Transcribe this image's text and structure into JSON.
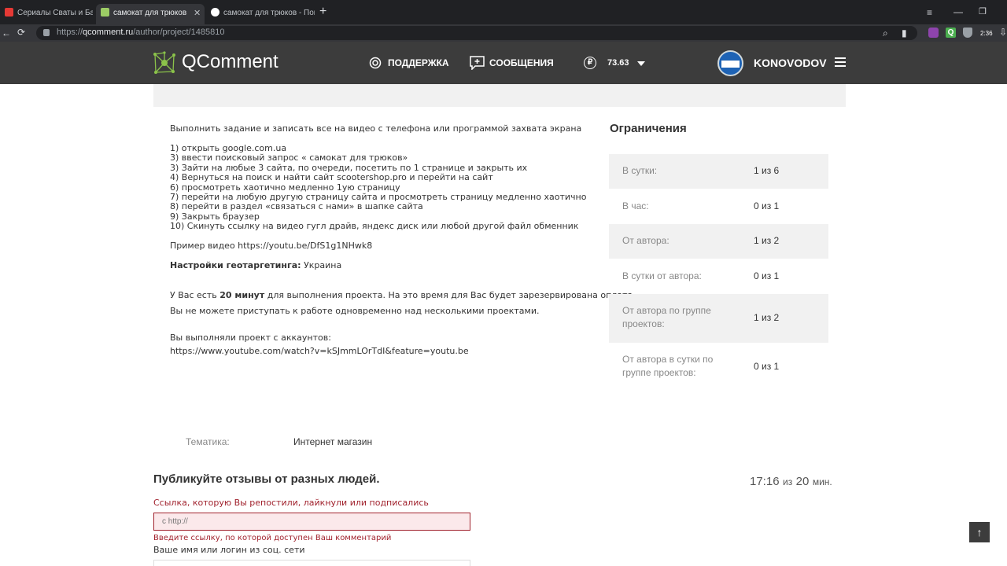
{
  "browser": {
    "tabs": [
      {
        "title": "Сериалы Сваты и Байки Мит",
        "active": false
      },
      {
        "title": "самокат для трюков",
        "active": true
      },
      {
        "title": "самокат для трюков - Пои",
        "active": false
      }
    ],
    "url_scheme": "https://",
    "url_host": "qcomment.ru",
    "url_path": "/author/project/1485810",
    "clock": "2:36"
  },
  "header": {
    "logo": "QComment",
    "support": "ПОДДЕРЖКА",
    "messages": "СООБЩЕНИЯ",
    "balance": "73.63",
    "username": "KONOVODOV"
  },
  "task": {
    "intro": "Выполнить задание и записать все на видео с телефона или программой захвата экрана",
    "steps": [
      "1) открыть google.com.ua",
      "3) ввести поисковый запрос « самокат для трюков»",
      "3) Зайти на любые 3 сайта, по очереди, посетить по 1 странице и закрыть их",
      "4) Вернуться на поиск и найти сайт scootershop.pro и перейти на сайт",
      "6) просмотреть хаотично медленно 1ую страницу",
      "7) перейти на любую другую страницу сайта и просмотреть страницу медленно хаотично",
      "8) перейти в раздел «связаться с нами» в шапке сайта",
      "9) Закрыть браузер",
      "10) Скинуть ссылку на видео гугл драйв, яндекс диск или любой другой файл обменник"
    ],
    "example": "Пример видео https://youtu.be/DfS1g1NHwk8",
    "geo_label": "Настройки геотаргетинга:",
    "geo_value": "Украина",
    "time_prefix": "У Вас есть",
    "time_bold": "20 минут",
    "time_suffix": "для выполнения проекта. На это время для Вас будет зарезервирована оплата.",
    "no_parallel": "Вы не можете приступать к работе одновременно над несколькими проектами.",
    "accounts_label": "Вы выполняли проект с аккаунтов:",
    "accounts_value": "https://www.youtube.com/watch?v=kSJmmLOrTdI&feature=youtu.be"
  },
  "limits": {
    "title": "Ограничения",
    "rows": [
      {
        "label": "В сутки:",
        "value": "1 из 6"
      },
      {
        "label": "В час:",
        "value": "0 из 1"
      },
      {
        "label": "От автора:",
        "value": "1 из 2"
      },
      {
        "label": "В сутки от автора:",
        "value": "0 из 1"
      },
      {
        "label": "От автора по группе проектов:",
        "value": "1 из 2"
      },
      {
        "label": "От автора в сутки по группе проектов:",
        "value": "0 из 1"
      }
    ]
  },
  "topic": {
    "label": "Тематика:",
    "value": "Интернет магазин"
  },
  "form": {
    "heading": "Публикуйте отзывы от разных людей.",
    "timer_value": "17:16",
    "timer_of": "из",
    "timer_total": "20",
    "timer_unit": "мин.",
    "link_label": "Ссылка, которую Вы репостили, лайкнули или подписались",
    "link_placeholder": "с http://",
    "link_error": "Введите ссылку, по которой доступен Ваш комментарий",
    "name_label": "Ваше имя или логин из соц. сети"
  },
  "scroll_top": "↑"
}
